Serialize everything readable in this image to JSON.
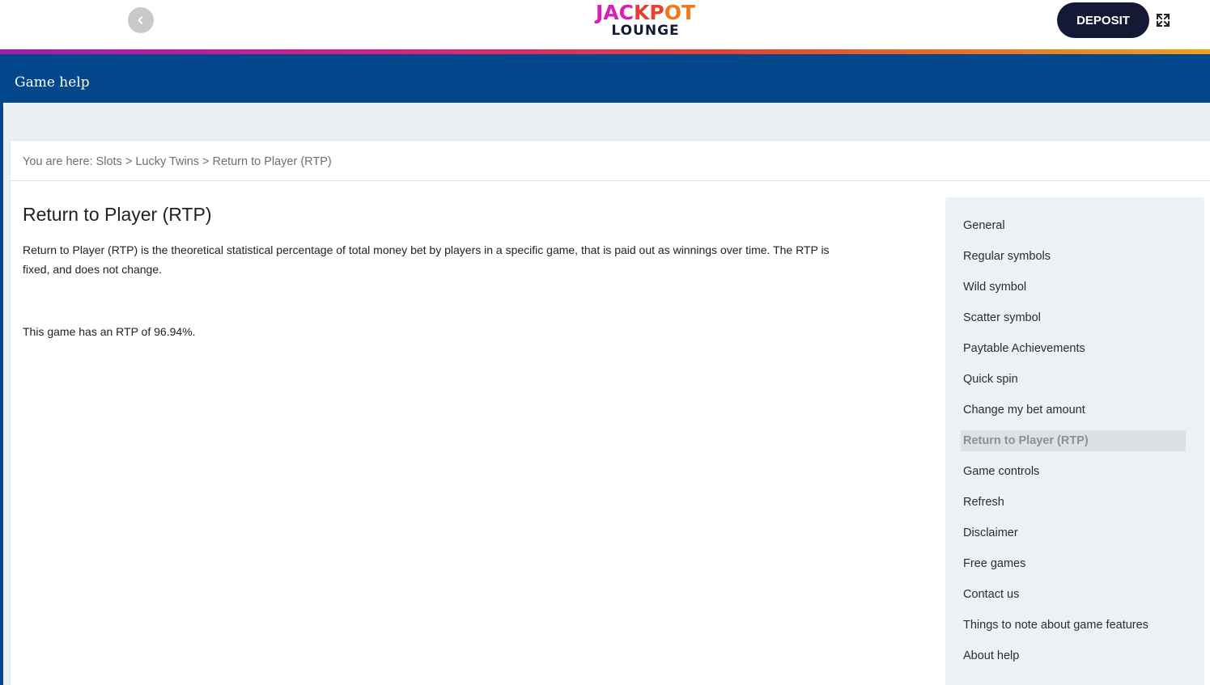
{
  "header": {
    "logo_line1": "JACKPOT",
    "logo_line2": "LOUNGE",
    "deposit_label": "DEPOSIT"
  },
  "title_bar": {
    "title": "Game help"
  },
  "breadcrumb": {
    "text": "You are here: Slots > Lucky Twins > Return to Player (RTP)"
  },
  "article": {
    "heading": "Return to Player (RTP)",
    "paragraph": "Return to Player (RTP) is the theoretical statistical percentage of total money bet by players in a specific game, that is paid out as winnings over time. The RTP is fixed, and does not change.",
    "rtp_text": "This game has an RTP of 96.94%."
  },
  "sidebar": {
    "items": [
      {
        "label": "General"
      },
      {
        "label": "Regular symbols"
      },
      {
        "label": "Wild symbol"
      },
      {
        "label": "Scatter symbol"
      },
      {
        "label": "Paytable Achievements"
      },
      {
        "label": "Quick spin"
      },
      {
        "label": "Change my bet amount"
      },
      {
        "label": "Return to Player (RTP)"
      },
      {
        "label": "Game controls"
      },
      {
        "label": "Refresh"
      },
      {
        "label": "Disclaimer"
      },
      {
        "label": "Free games"
      },
      {
        "label": "Contact us"
      },
      {
        "label": "Things to note about game features"
      },
      {
        "label": "About help"
      }
    ],
    "active_item": "Return to Player (RTP)"
  },
  "icons": {
    "back": "chevron-left-icon",
    "fullscreen": "expand-icon"
  },
  "colors": {
    "brand_navy": "#141a35",
    "title_bar_blue": "#03478c",
    "logo_magenta": "#d61fb6",
    "logo_orange": "#f0771a"
  }
}
